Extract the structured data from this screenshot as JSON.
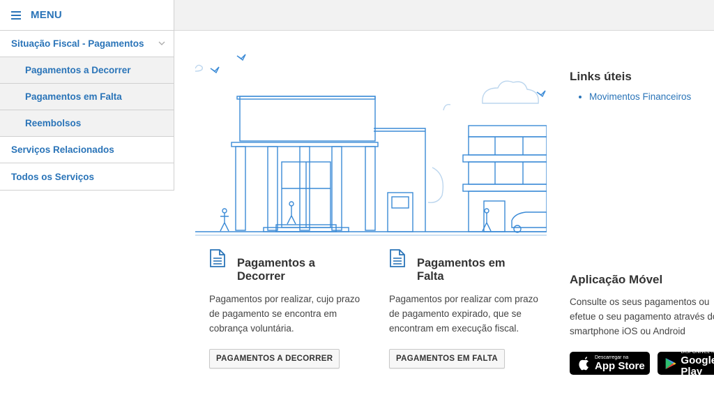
{
  "menu": {
    "label": "MENU"
  },
  "sidebar": {
    "items": [
      {
        "label": "Situação Fiscal - Pagamentos",
        "sub": false
      },
      {
        "label": "Pagamentos a Decorrer",
        "sub": true
      },
      {
        "label": "Pagamentos em Falta",
        "sub": true
      },
      {
        "label": "Reembolsos",
        "sub": true
      },
      {
        "label": "Serviços Relacionados",
        "sub": false
      },
      {
        "label": "Todos os Serviços",
        "sub": false
      }
    ]
  },
  "cards": [
    {
      "title": "Pagamentos a Decorrer",
      "description": "Pagamentos por realizar, cujo prazo de pagamento se encontra em cobrança voluntária.",
      "button": "PAGAMENTOS A DECORRER"
    },
    {
      "title": "Pagamentos em Falta",
      "description": "Pagamentos por realizar com prazo de pagamento expirado, que se encontram em execução fiscal.",
      "button": "PAGAMENTOS EM FALTA"
    }
  ],
  "links": {
    "title": "Links úteis",
    "items": [
      "Movimentos Financeiros"
    ]
  },
  "app": {
    "title": "Aplicação Móvel",
    "line1": "Consulte os seus pagamentos ou",
    "line2": "efetue o seu pagamento através do",
    "line3": "smartphone iOS ou Android",
    "appstore_small": "Descarregar na",
    "appstore_big": "App Store",
    "google_small": "DISPONÍVEL NO",
    "google_big": "Google Play"
  },
  "colors": {
    "accent": "#2a74b8",
    "illustration": "#3a8ad6"
  },
  "icons": [
    "hamburger-icon",
    "chevron-down-icon",
    "document-icon",
    "apple-icon",
    "google-play-icon"
  ]
}
